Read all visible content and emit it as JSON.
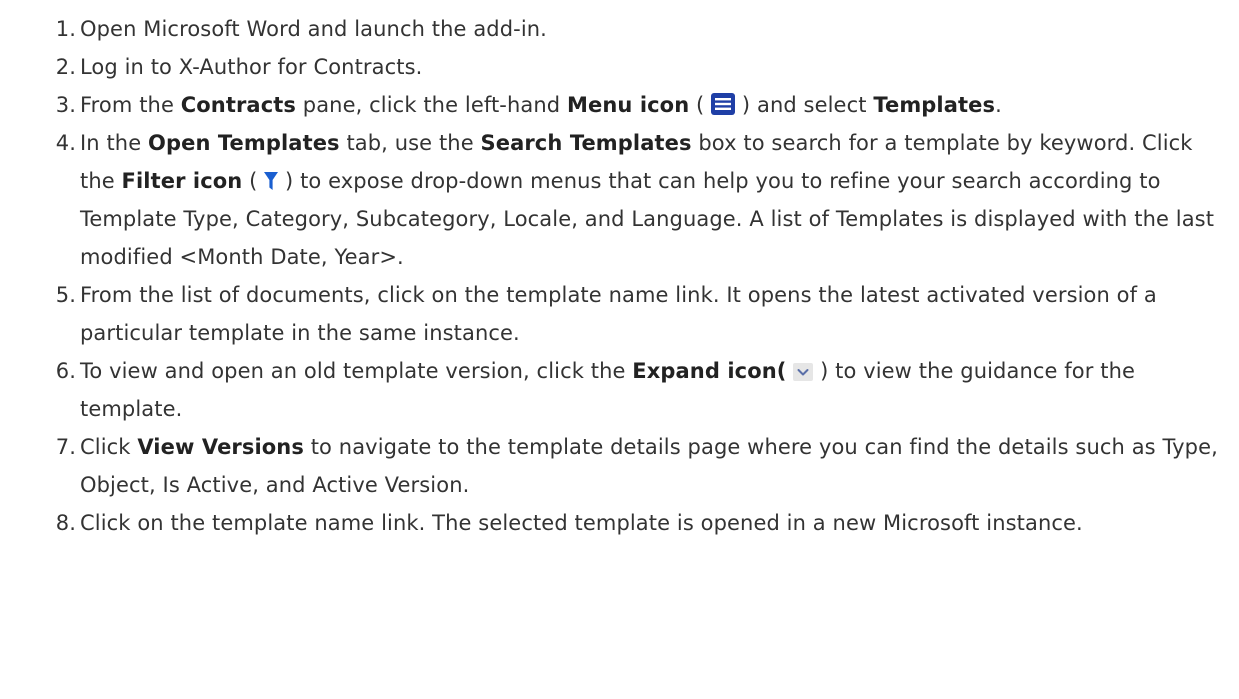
{
  "colors": {
    "text": "#333333",
    "menu_icon": "#1f3fa6",
    "filter_icon": "#1a5fd0",
    "expand_icon_bg": "#e6e6e6",
    "expand_icon_chevron": "#5a6fa8"
  },
  "steps": [
    {
      "number": "1.",
      "parts": [
        {
          "text": "Open Microsoft Word and launch the add-in."
        }
      ]
    },
    {
      "number": "2.",
      "parts": [
        {
          "text": "Log in to X-Author for Contracts."
        }
      ]
    },
    {
      "number": "3.",
      "parts": [
        {
          "text": "From the "
        },
        {
          "text": "Contracts",
          "bold": true
        },
        {
          "text": " pane, click the left-hand "
        },
        {
          "text": "Menu icon",
          "bold": true
        },
        {
          "text": " ("
        },
        {
          "icon": "menu-icon"
        },
        {
          "text": ") and select "
        },
        {
          "text": "Templates",
          "bold": true
        },
        {
          "text": "."
        }
      ]
    },
    {
      "number": "4.",
      "parts": [
        {
          "text": "In the "
        },
        {
          "text": "Open Templates",
          "bold": true
        },
        {
          "text": " tab, use the "
        },
        {
          "text": "Search Templates",
          "bold": true
        },
        {
          "text": " box to search for a template by keyword. Click the "
        },
        {
          "text": "Filter icon",
          "bold": true
        },
        {
          "text": " ( "
        },
        {
          "icon": "filter-icon"
        },
        {
          "text": " ) to expose drop-down menus that can help you to refine your search according to Template Type, Category, Subcategory, Locale, and Language. A list of Templates is displayed with the last modified <Month Date, Year>."
        }
      ]
    },
    {
      "number": "5.",
      "parts": [
        {
          "text": "From the list of documents, click on the template name link. It opens the latest activated version of a particular template in the same instance."
        }
      ]
    },
    {
      "number": "6.",
      "parts": [
        {
          "text": "To view and open an old template version, click the "
        },
        {
          "text": "Expand icon(",
          "bold": true
        },
        {
          "text": " "
        },
        {
          "icon": "expand-icon"
        },
        {
          "text": " ) to view the guidance for the template."
        }
      ]
    },
    {
      "number": "7.",
      "parts": [
        {
          "text": "Click "
        },
        {
          "text": "View Versions",
          "bold": true
        },
        {
          "text": " to navigate to the template details page where you can find the details such as Type, Object, Is Active, and Active Version."
        }
      ]
    },
    {
      "number": "8.",
      "parts": [
        {
          "text": "Click on the template name link. The selected template is opened in a new Microsoft instance."
        }
      ]
    }
  ]
}
